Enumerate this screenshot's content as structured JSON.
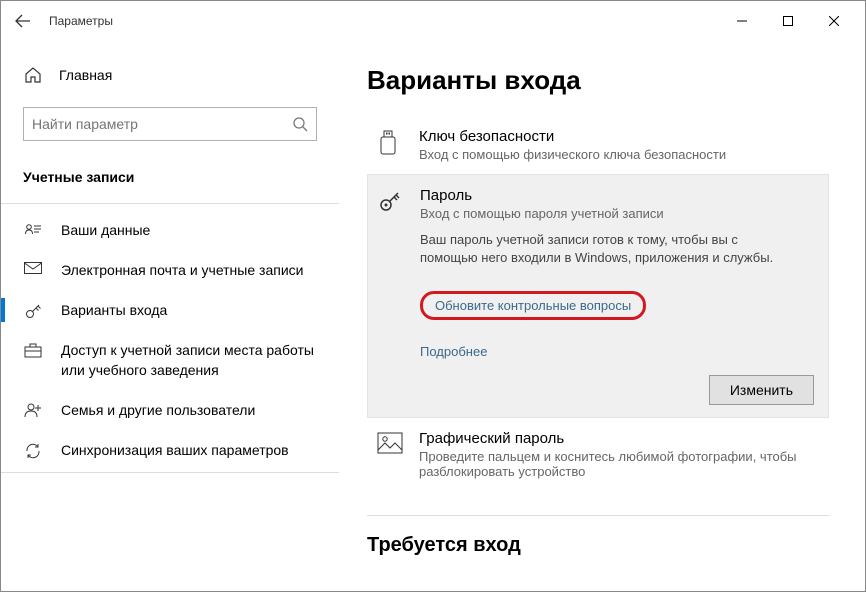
{
  "window": {
    "title": "Параметры"
  },
  "sidebar": {
    "home_label": "Главная",
    "search_placeholder": "Найти параметр",
    "section_label": "Учетные записи",
    "items": [
      {
        "label": "Ваши данные"
      },
      {
        "label": "Электронная почта и учетные записи"
      },
      {
        "label": "Варианты входа"
      },
      {
        "label": "Доступ к учетной записи места работы или учебного заведения"
      },
      {
        "label": "Семья и другие пользователи"
      },
      {
        "label": "Синхронизация ваших параметров"
      }
    ]
  },
  "content": {
    "heading": "Варианты входа",
    "security_key": {
      "title": "Ключ безопасности",
      "sub": "Вход с помощью физического ключа безопасности"
    },
    "password": {
      "title": "Пароль",
      "sub": "Вход с помощью пароля учетной записи",
      "desc": "Ваш пароль учетной записи готов к тому, чтобы вы с помощью него входили в Windows, приложения и службы.",
      "link_questions": "Обновите контрольные вопросы",
      "link_more": "Подробнее",
      "change_button": "Изменить"
    },
    "picture_password": {
      "title": "Графический пароль",
      "sub": "Проведите пальцем и коснитесь любимой фотографии, чтобы разблокировать устройство"
    },
    "heading2": "Требуется вход"
  }
}
